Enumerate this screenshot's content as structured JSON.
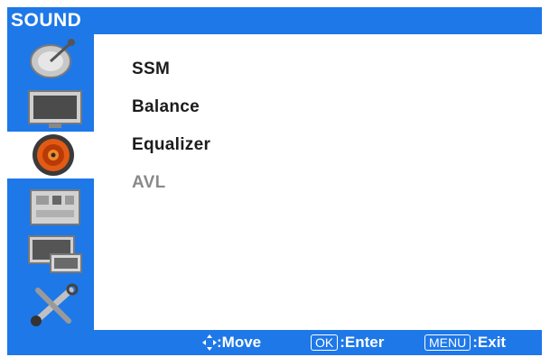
{
  "header": {
    "title": "SOUND"
  },
  "sidebar": {
    "items": [
      {
        "icon": "satellite-dish-icon",
        "active": false
      },
      {
        "icon": "picture-monitor-icon",
        "active": false
      },
      {
        "icon": "speaker-icon",
        "active": true
      },
      {
        "icon": "settings-panel-icon",
        "active": false
      },
      {
        "icon": "screen-setup-icon",
        "active": false
      },
      {
        "icon": "tools-icon",
        "active": false
      }
    ]
  },
  "menu": {
    "items": [
      {
        "label": "SSM",
        "enabled": true
      },
      {
        "label": "Balance",
        "enabled": true
      },
      {
        "label": "Equalizer",
        "enabled": true
      },
      {
        "label": "AVL",
        "enabled": false
      }
    ]
  },
  "footer": {
    "move_label": ":Move",
    "ok_key": "OK",
    "enter_label": ":Enter",
    "menu_key": "MENU",
    "exit_label": ":Exit"
  },
  "colors": {
    "accent": "#1e78e8",
    "text": "#1c1c1c",
    "disabled": "#8a8a8a"
  }
}
